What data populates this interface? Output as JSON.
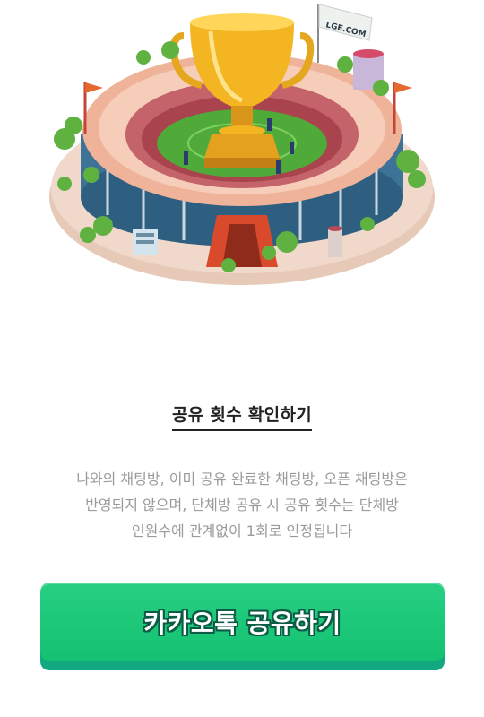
{
  "hero": {
    "flag_text": "LGE.COM"
  },
  "section": {
    "title": "공유 횟수 확인하기",
    "description_lines": [
      "나와의 채팅방, 이미 공유 완료한 채팅방, 오픈 채팅방은",
      "반영되지 않으며, 단체방 공유 시 공유 횟수는 단체방",
      "인원수에 관계없이 1회로 인정됩니다"
    ]
  },
  "share_button": {
    "label": "카카오톡 공유하기"
  },
  "colors": {
    "button_green": "#1ec779",
    "button_shadow": "#12a880",
    "text_dark": "#222222",
    "text_muted": "#9a9a9a"
  },
  "icons": {
    "hero_image": "stadium-trophy-illustration"
  }
}
